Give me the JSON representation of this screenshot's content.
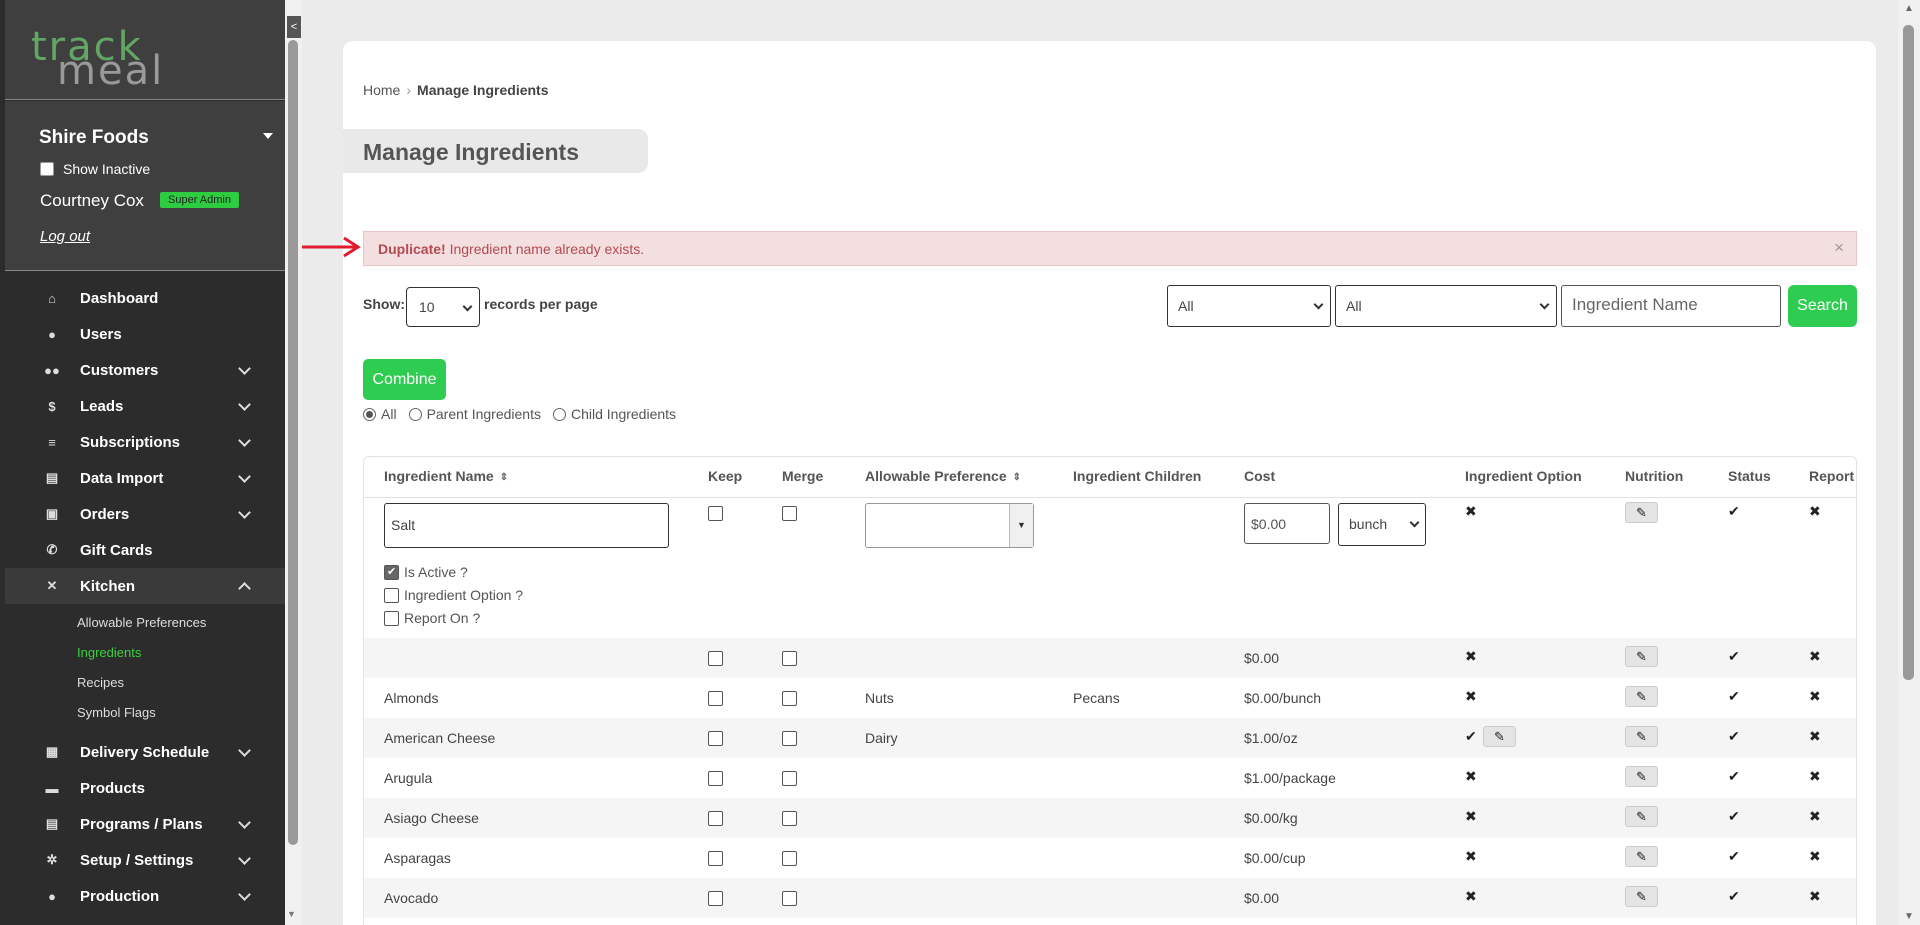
{
  "logo": {
    "part1": "meal",
    "part2": "track"
  },
  "account": {
    "company": "Shire Foods",
    "show_inactive": "Show Inactive",
    "user": "Courtney Cox",
    "role": "Super Admin",
    "logout": "Log out"
  },
  "nav": [
    {
      "label": "Dashboard",
      "icon": "home-icon",
      "glyph": "⌂"
    },
    {
      "label": "Users",
      "icon": "user-icon",
      "glyph": "●"
    },
    {
      "label": "Customers",
      "icon": "users-icon",
      "glyph": "●●"
    },
    {
      "label": "Leads",
      "icon": "dollar-icon",
      "glyph": "$"
    },
    {
      "label": "Subscriptions",
      "icon": "layers-icon",
      "glyph": "≡"
    },
    {
      "label": "Data Import",
      "icon": "file-icon",
      "glyph": "▤"
    },
    {
      "label": "Orders",
      "icon": "bag-icon",
      "glyph": "▣"
    },
    {
      "label": "Gift Cards",
      "icon": "phone-icon",
      "glyph": "✆"
    },
    {
      "label": "Kitchen",
      "icon": "utensils-icon",
      "glyph": "✕"
    }
  ],
  "kitchen_sub": [
    "Allowable Preferences",
    "Ingredients",
    "Recipes",
    "Symbol Flags"
  ],
  "nav2": [
    {
      "label": "Delivery Schedule",
      "icon": "calendar-icon",
      "glyph": "▦"
    },
    {
      "label": "Products",
      "icon": "box-icon",
      "glyph": "▬"
    },
    {
      "label": "Programs / Plans",
      "icon": "clipboard-icon",
      "glyph": "▤"
    },
    {
      "label": "Setup / Settings",
      "icon": "gear-icon",
      "glyph": "✲"
    },
    {
      "label": "Production",
      "icon": "person-icon",
      "glyph": "●"
    }
  ],
  "breadcrumb": {
    "home": "Home",
    "sep": "›",
    "current": "Manage Ingredients"
  },
  "page_title": "Manage Ingredients",
  "alert": {
    "strong": "Duplicate!",
    "message": "Ingredient name already exists.",
    "close": "×"
  },
  "toolbar": {
    "show": "Show:",
    "page_size": "10",
    "records": "records per page",
    "filter1": "All",
    "filter2": "All",
    "search_placeholder": "Ingredient Name",
    "search": "Search",
    "combine": "Combine"
  },
  "radios": {
    "all": "All",
    "parent": "Parent Ingredients",
    "child": "Child Ingredients"
  },
  "columns": [
    "Ingredient Name",
    "Keep",
    "Merge",
    "Allowable Preference",
    "Ingredient Children",
    "Cost",
    "Ingredient Option",
    "Nutrition",
    "Status",
    "Report"
  ],
  "edit_row": {
    "name": "Salt",
    "cost": "$0.00",
    "unit": "bunch",
    "is_active": "Is Active ?",
    "ingredient_option": "Ingredient Option ?",
    "report_on": "Report On ?"
  },
  "rows": [
    {
      "name": "",
      "pref": "",
      "children": "",
      "cost": "$0.00",
      "option": "✖",
      "option_edit": false
    },
    {
      "name": "Almonds",
      "pref": "Nuts",
      "children": "Pecans",
      "cost": "$0.00/bunch",
      "option": "✖",
      "option_edit": false
    },
    {
      "name": "American Cheese",
      "pref": "Dairy",
      "children": "",
      "cost": "$1.00/oz",
      "option": "✔",
      "option_edit": true
    },
    {
      "name": "Arugula",
      "pref": "",
      "children": "",
      "cost": "$1.00/package",
      "option": "✖",
      "option_edit": false
    },
    {
      "name": "Asiago Cheese",
      "pref": "",
      "children": "",
      "cost": "$0.00/kg",
      "option": "✖",
      "option_edit": false
    },
    {
      "name": "Asparagas",
      "pref": "",
      "children": "",
      "cost": "$0.00/cup",
      "option": "✖",
      "option_edit": false
    },
    {
      "name": "Avocado",
      "pref": "",
      "children": "",
      "cost": "$0.00",
      "option": "✖",
      "option_edit": false
    }
  ],
  "glyphs": {
    "pencil": "✎",
    "check": "✔",
    "cross": "✖"
  },
  "colors": {
    "accent": "#2ecc51",
    "sidebar": "#2c2c2c",
    "alert_bg": "#f3dfe0",
    "alert_text": "#b34a54"
  }
}
